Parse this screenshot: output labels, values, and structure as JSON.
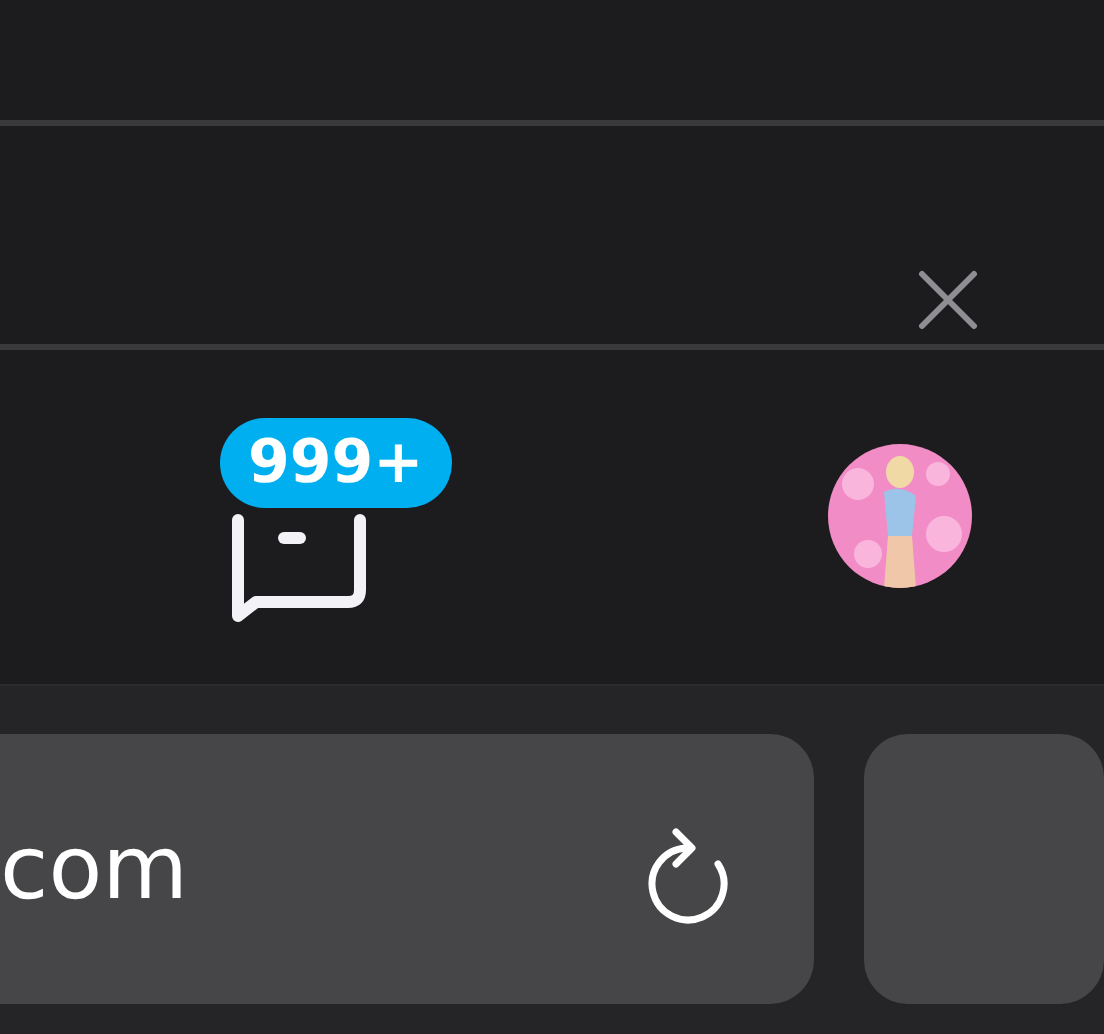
{
  "messages": {
    "badge": "999+"
  },
  "address_bar": {
    "url": "com"
  }
}
